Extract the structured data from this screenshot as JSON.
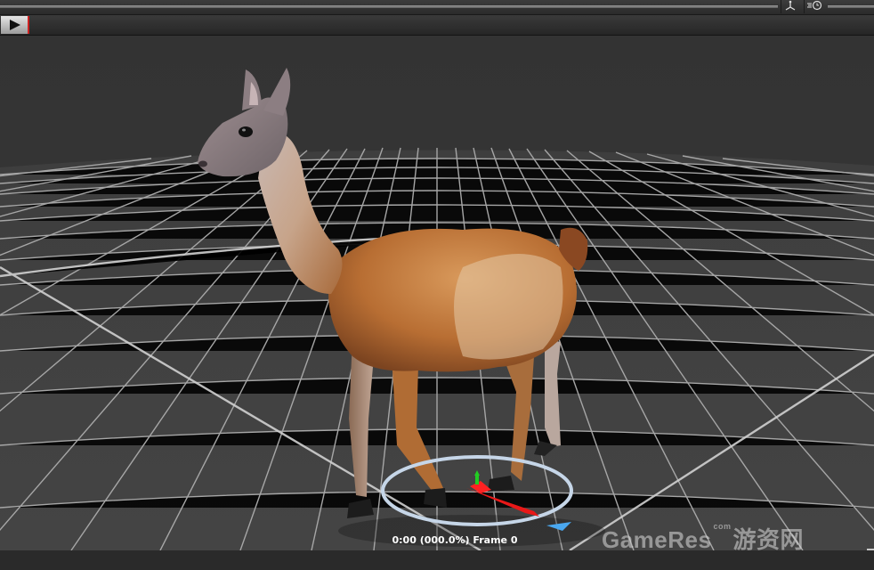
{
  "status": {
    "time": "0:00",
    "percent": "(000.0%)",
    "frame_label": "Frame 0"
  },
  "watermark": {
    "brand": "GameRes",
    "sub": "com",
    "cn": "游资网"
  },
  "icons": {
    "play": "play-icon",
    "transform": "axis-icon",
    "timer": "clock-icon"
  },
  "colors": {
    "play_accent": "#cc2222",
    "grid": "#bdbdbd",
    "floor": "#3a3a3a"
  }
}
